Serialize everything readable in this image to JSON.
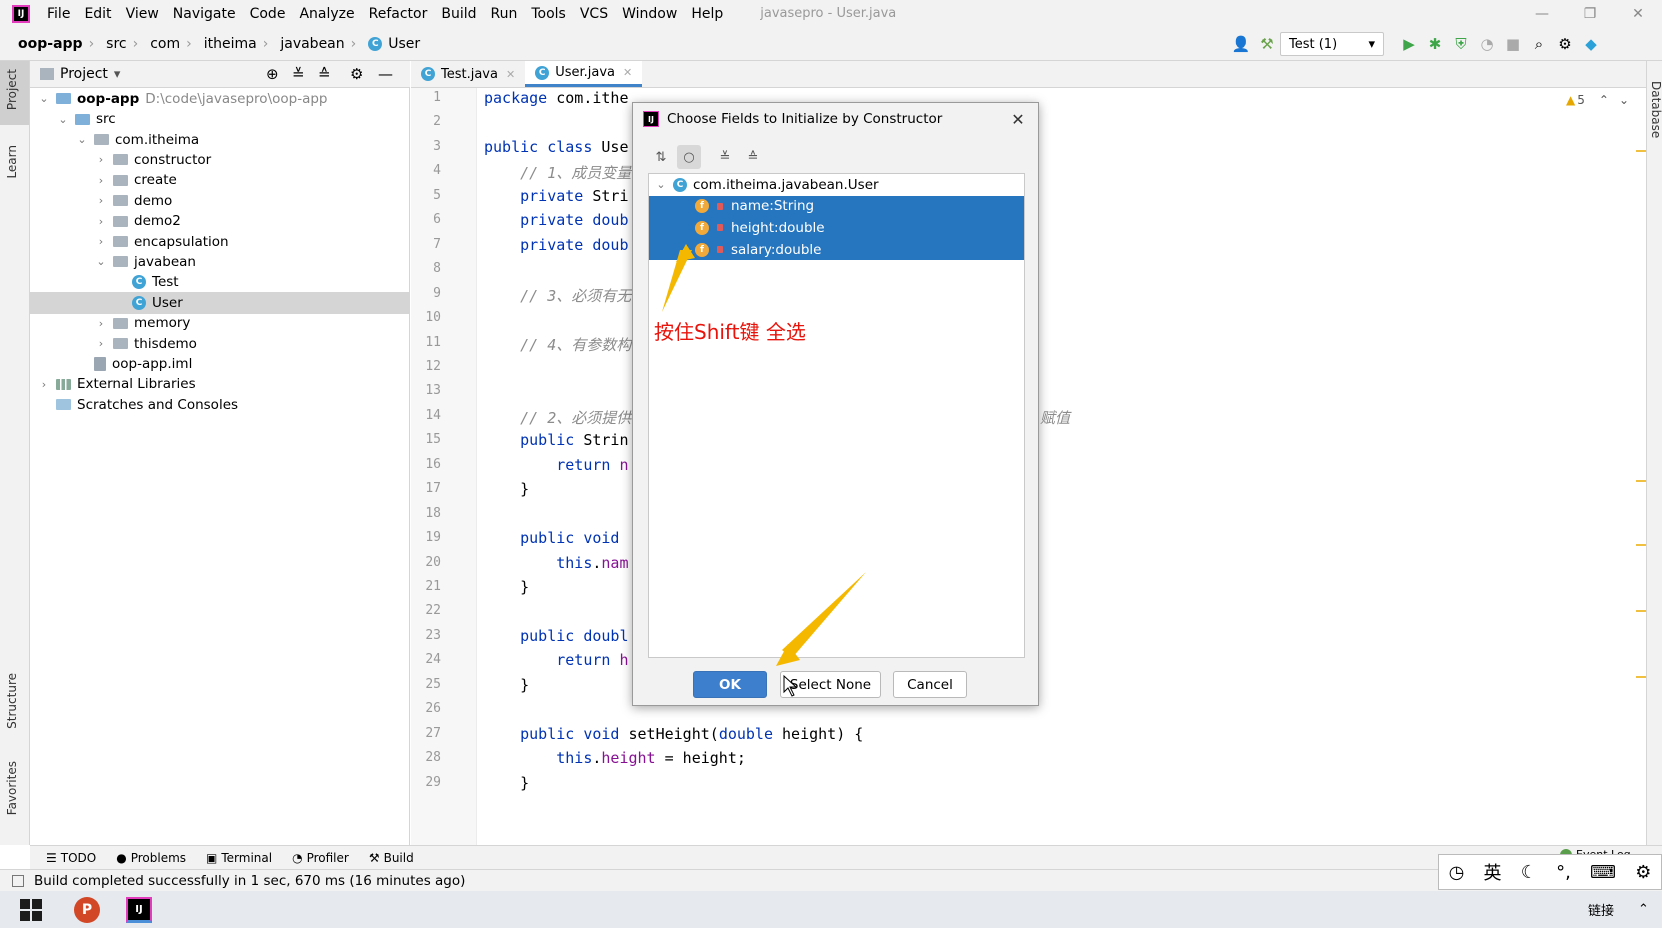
{
  "menubar": {
    "items": [
      "File",
      "Edit",
      "View",
      "Navigate",
      "Code",
      "Analyze",
      "Refactor",
      "Build",
      "Run",
      "Tools",
      "VCS",
      "Window",
      "Help"
    ],
    "window_title": "javasepro - User.java"
  },
  "breadcrumb": [
    "oop-app",
    "src",
    "com",
    "itheima",
    "javabean",
    "User"
  ],
  "run_config": "Test (1)",
  "left_strip": {
    "project": "Project",
    "learn": "Learn",
    "structure": "Structure",
    "favorites": "Favorites"
  },
  "right_strip": {
    "database": "Database"
  },
  "project_panel": {
    "title": "Project",
    "tree": [
      {
        "label": "oop-app",
        "extra": "D:\\code\\javasepro\\oop-app",
        "level": 0,
        "expanded": true,
        "kind": "module",
        "bold": true
      },
      {
        "label": "src",
        "level": 1,
        "expanded": true,
        "kind": "src"
      },
      {
        "label": "com.itheima",
        "level": 2,
        "expanded": true,
        "kind": "pkg"
      },
      {
        "label": "constructor",
        "level": 3,
        "expanded": false,
        "kind": "pkg"
      },
      {
        "label": "create",
        "level": 3,
        "expanded": false,
        "kind": "pkg"
      },
      {
        "label": "demo",
        "level": 3,
        "expanded": false,
        "kind": "pkg"
      },
      {
        "label": "demo2",
        "level": 3,
        "expanded": false,
        "kind": "pkg"
      },
      {
        "label": "encapsulation",
        "level": 3,
        "expanded": false,
        "kind": "pkg"
      },
      {
        "label": "javabean",
        "level": 3,
        "expanded": true,
        "kind": "pkg"
      },
      {
        "label": "Test",
        "level": 4,
        "kind": "class"
      },
      {
        "label": "User",
        "level": 4,
        "kind": "class",
        "selected": true
      },
      {
        "label": "memory",
        "level": 3,
        "expanded": false,
        "kind": "pkg"
      },
      {
        "label": "thisdemo",
        "level": 3,
        "expanded": false,
        "kind": "pkg"
      },
      {
        "label": "oop-app.iml",
        "level": 2,
        "kind": "file"
      },
      {
        "label": "External Libraries",
        "level": 0,
        "expanded": false,
        "kind": "lib"
      },
      {
        "label": "Scratches and Consoles",
        "level": 0,
        "kind": "scratch"
      }
    ]
  },
  "editor": {
    "tabs": [
      {
        "label": "Test.java",
        "active": false
      },
      {
        "label": "User.java",
        "active": true
      }
    ],
    "warnings": "5",
    "lines": [
      {
        "n": 1,
        "parts": [
          [
            "kw",
            "package "
          ],
          [
            "",
            "com.ithe"
          ]
        ]
      },
      {
        "n": 2,
        "parts": []
      },
      {
        "n": 3,
        "parts": [
          [
            "kw",
            "public class "
          ],
          [
            "",
            "Use"
          ]
        ]
      },
      {
        "n": 4,
        "parts": [
          [
            "cm",
            "    // 1、成员变量"
          ]
        ]
      },
      {
        "n": 5,
        "parts": [
          [
            "kw",
            "    private "
          ],
          [
            "",
            "Stri"
          ]
        ]
      },
      {
        "n": 6,
        "parts": [
          [
            "kw",
            "    private "
          ],
          [
            "kw",
            "doub"
          ]
        ]
      },
      {
        "n": 7,
        "parts": [
          [
            "kw",
            "    private "
          ],
          [
            "kw",
            "doub"
          ]
        ]
      },
      {
        "n": 8,
        "parts": []
      },
      {
        "n": 9,
        "parts": [
          [
            "cm",
            "    // 3、必须有无"
          ]
        ]
      },
      {
        "n": 10,
        "parts": []
      },
      {
        "n": 11,
        "parts": [
          [
            "cm",
            "    // 4、有参数构"
          ]
        ]
      },
      {
        "n": 12,
        "parts": []
      },
      {
        "n": 13,
        "parts": []
      },
      {
        "n": 14,
        "parts": [
          [
            "cm",
            "    // 2、必须提供"
          ]
        ]
      },
      {
        "n": 15,
        "parts": [
          [
            "kw",
            "    public "
          ],
          [
            "",
            "Strin"
          ]
        ]
      },
      {
        "n": 16,
        "parts": [
          [
            "kw",
            "        return "
          ],
          [
            "fld",
            "n"
          ]
        ]
      },
      {
        "n": 17,
        "parts": [
          [
            "",
            "    }"
          ]
        ]
      },
      {
        "n": 18,
        "parts": []
      },
      {
        "n": 19,
        "parts": [
          [
            "kw",
            "    public void"
          ]
        ]
      },
      {
        "n": 20,
        "parts": [
          [
            "kw",
            "        this"
          ],
          [
            "",
            "."
          ],
          [
            "fld",
            "nam"
          ]
        ]
      },
      {
        "n": 21,
        "parts": [
          [
            "",
            "    }"
          ]
        ]
      },
      {
        "n": 22,
        "parts": []
      },
      {
        "n": 23,
        "parts": [
          [
            "kw",
            "    public doubl"
          ]
        ]
      },
      {
        "n": 24,
        "parts": [
          [
            "kw",
            "        return "
          ],
          [
            "fld",
            "h"
          ]
        ]
      },
      {
        "n": 25,
        "parts": [
          [
            "",
            "    }"
          ]
        ]
      },
      {
        "n": 26,
        "parts": []
      },
      {
        "n": 27,
        "parts": [
          [
            "kw",
            "    public void "
          ],
          [
            "",
            "setHeight("
          ],
          [
            "kw",
            "double "
          ],
          [
            "",
            "height) {"
          ]
        ]
      },
      {
        "n": 28,
        "parts": [
          [
            "kw",
            "        this"
          ],
          [
            "",
            "."
          ],
          [
            "fld",
            "height"
          ],
          [
            "",
            " = height;"
          ]
        ]
      },
      {
        "n": 29,
        "parts": [
          [
            "",
            "    }"
          ]
        ]
      }
    ],
    "line14_tail": "赋值"
  },
  "dialog": {
    "title": "Choose Fields to Initialize by Constructor",
    "root": "com.itheima.javabean.User",
    "fields": [
      "name:String",
      "height:double",
      "salary:double"
    ],
    "ok": "OK",
    "select_none": "Select None",
    "cancel": "Cancel"
  },
  "annotation": "按住Shift键 全选",
  "tool_windows": [
    "TODO",
    "Problems",
    "Terminal",
    "Profiler",
    "Build"
  ],
  "event_log": "Event Log",
  "status": "Build completed successfully in 1 sec, 670 ms (16 minutes ago)",
  "ime": {
    "lang": "英"
  },
  "taskbar": {
    "tray_text": "链接"
  }
}
